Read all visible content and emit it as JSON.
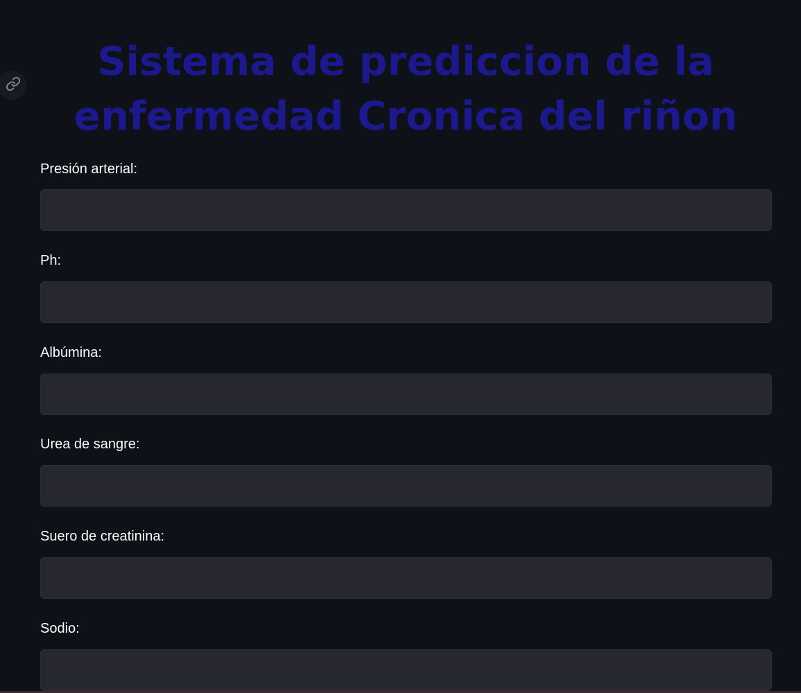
{
  "header": {
    "title": "Sistema de prediccion de la enfermedad Cronica del riñon",
    "anchor_icon": "link-icon"
  },
  "form": {
    "fields": [
      {
        "label": "Presión arterial:",
        "value": "",
        "placeholder": ""
      },
      {
        "label": "Ph:",
        "value": "",
        "placeholder": ""
      },
      {
        "label": "Albúmina:",
        "value": "",
        "placeholder": ""
      },
      {
        "label": "Urea de sangre:",
        "value": "",
        "placeholder": ""
      },
      {
        "label": "Suero de creatinina:",
        "value": "",
        "placeholder": ""
      },
      {
        "label": "Sodio:",
        "value": "",
        "placeholder": ""
      }
    ]
  },
  "colors": {
    "background": "#0e1117",
    "title": "#1b198c",
    "input_background": "#262730",
    "label_text": "#fafafa"
  }
}
